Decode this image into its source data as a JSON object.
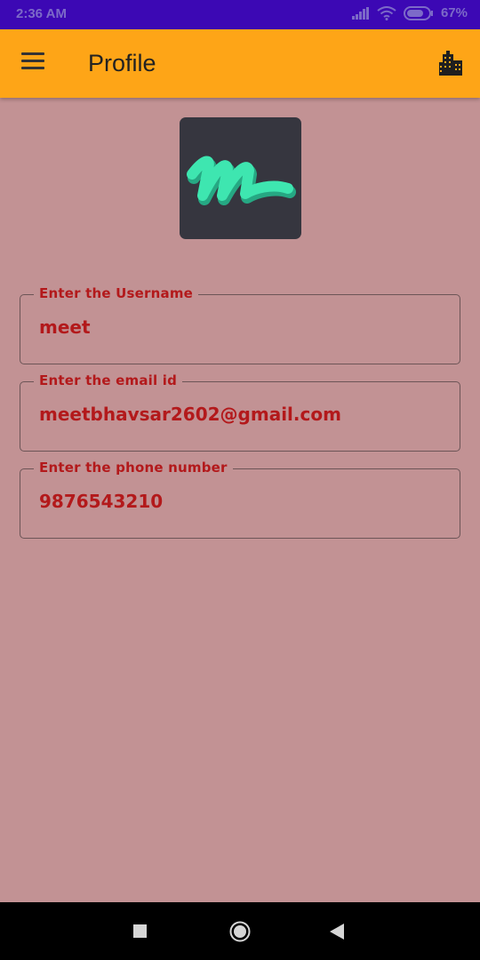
{
  "status_bar": {
    "time": "2:36 AM",
    "battery": "67%"
  },
  "app_bar": {
    "title": "Profile",
    "menu_icon": "hamburger-menu-icon",
    "action_icon": "building-icon"
  },
  "colors": {
    "status_bar_bg": "#3c08b4",
    "app_bar_bg": "#fea517",
    "page_bg": "#c29294",
    "field_text": "#b3191b",
    "logo_bg": "#36363f",
    "logo_mark": "#3ee6b0"
  },
  "form": {
    "fields": [
      {
        "label": "Enter the Username",
        "value": "meet"
      },
      {
        "label": "Enter the email id",
        "value": "meetbhavsar2602@gmail.com"
      },
      {
        "label": "Enter the phone number",
        "value": "9876543210"
      }
    ]
  },
  "nav": {
    "icons": [
      "recents-square-icon",
      "home-circle-icon",
      "back-triangle-icon"
    ]
  }
}
